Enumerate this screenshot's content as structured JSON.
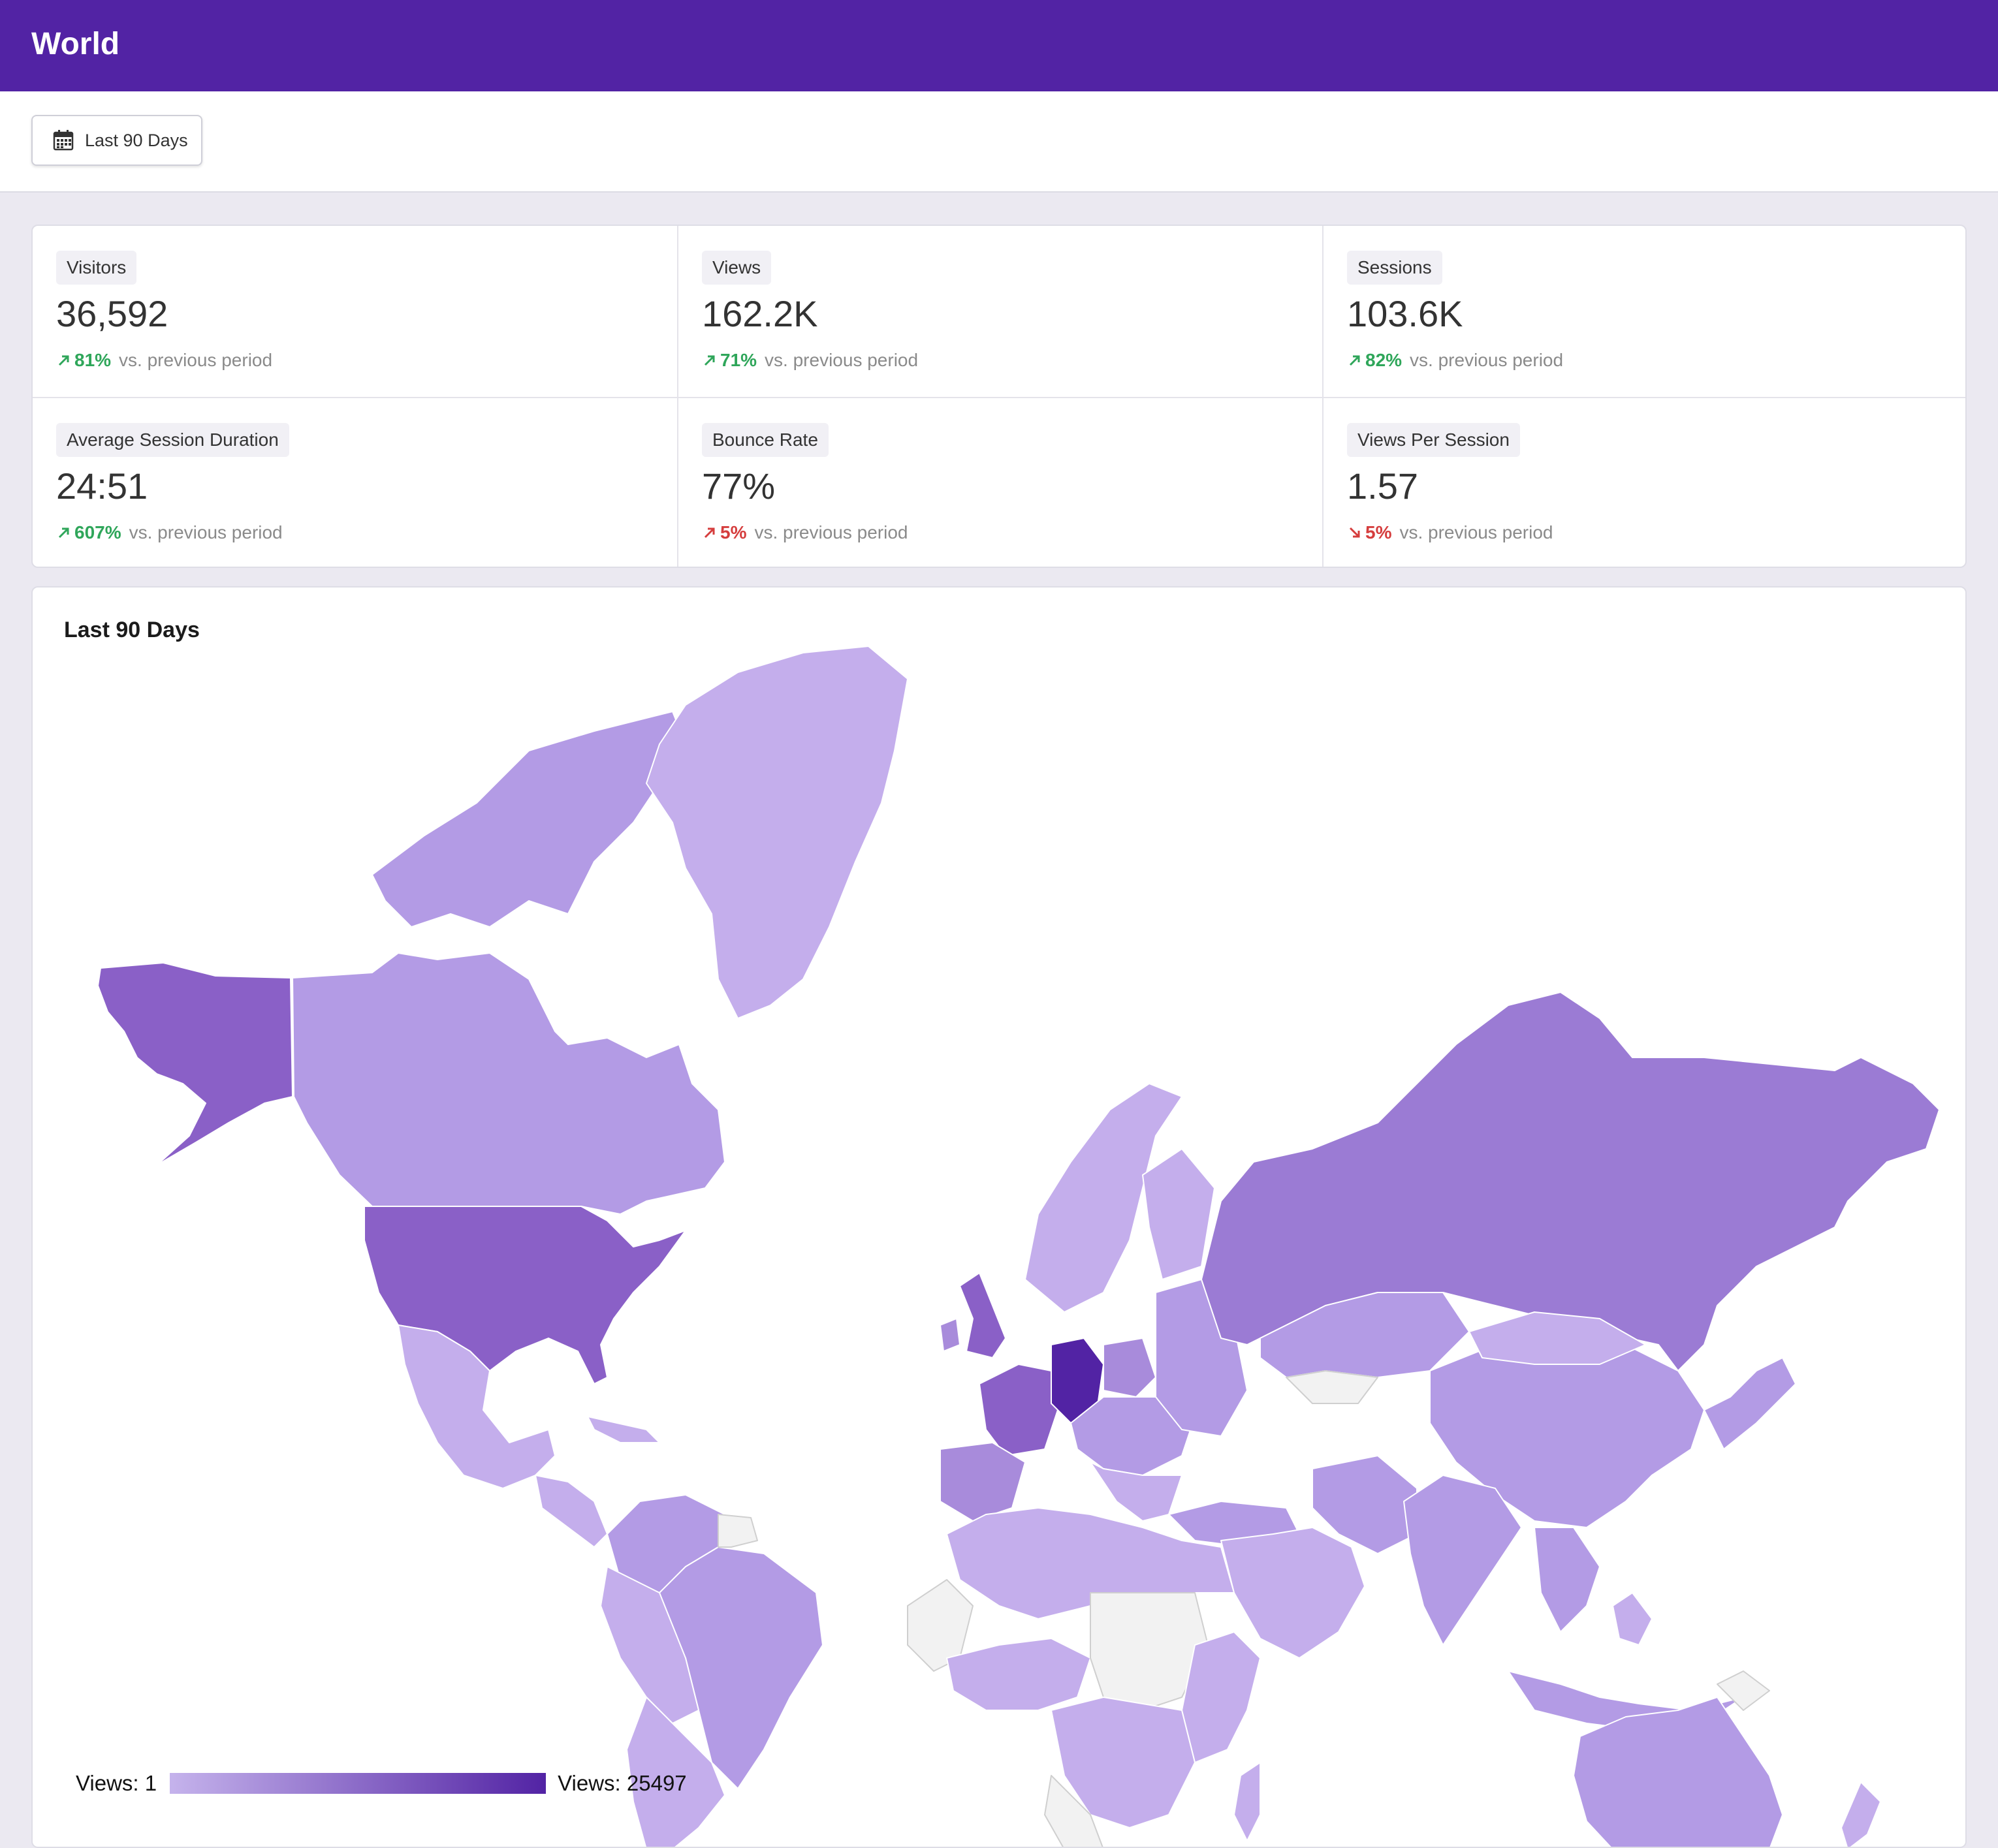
{
  "header": {
    "title": "World"
  },
  "toolbar": {
    "range_label": "Last 90 Days"
  },
  "stats": [
    {
      "label": "Visitors",
      "value": "36,592",
      "change": "81%",
      "direction": "up",
      "sentiment": "good",
      "suffix": "vs. previous period"
    },
    {
      "label": "Views",
      "value": "162.2K",
      "change": "71%",
      "direction": "up",
      "sentiment": "good",
      "suffix": "vs. previous period"
    },
    {
      "label": "Sessions",
      "value": "103.6K",
      "change": "82%",
      "direction": "up",
      "sentiment": "good",
      "suffix": "vs. previous period"
    },
    {
      "label": "Average Session Duration",
      "value": "24:51",
      "change": "607%",
      "direction": "up",
      "sentiment": "good",
      "suffix": "vs. previous period"
    },
    {
      "label": "Bounce Rate",
      "value": "77%",
      "change": "5%",
      "direction": "up",
      "sentiment": "bad",
      "suffix": "vs. previous period"
    },
    {
      "label": "Views Per Session",
      "value": "1.57",
      "change": "5%",
      "direction": "down",
      "sentiment": "bad",
      "suffix": "vs. previous period"
    }
  ],
  "map": {
    "title": "Last 90 Days",
    "legend_min": "Views: 1",
    "legend_max": "Views: 25497",
    "colors": {
      "low": "#c5b3ec",
      "high": "#5223a4",
      "no_data": "#f2f2f2",
      "accent_green": "#2fa65a",
      "accent_red": "#d53d3d"
    }
  }
}
